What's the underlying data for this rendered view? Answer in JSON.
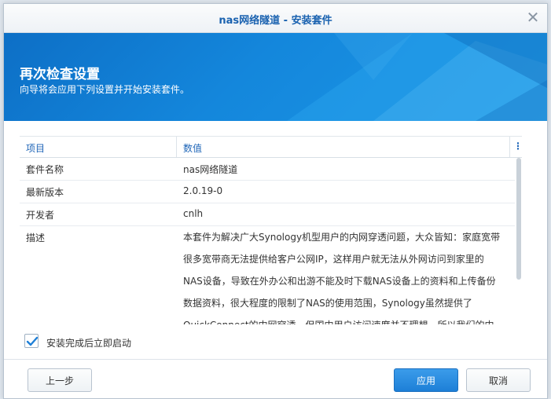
{
  "window": {
    "title": "nas网络隧道 - 安装套件",
    "close_glyph": "✕"
  },
  "banner": {
    "title": "再次检查设置",
    "subtitle": "向导将会应用下列设置并开始安装套件。"
  },
  "grid": {
    "headers": [
      "项目",
      "数值"
    ],
    "rows": [
      {
        "key": "套件名称",
        "value": "nas网络隧道"
      },
      {
        "key": "最新版本",
        "value": "2.0.19-0"
      },
      {
        "key": "开发者",
        "value": "cnlh"
      }
    ],
    "description": {
      "key": "描述",
      "lines": [
        "本套件为解决广大Synology机型用户的内网穿透问题，大众皆知：家庭宽带",
        "很多宽带商无法提供给客户公网IP，这样用户就无法从外网访问到家里的",
        "NAS设备，导致在外办公和出游不能及时下载NAS设备上的资料和上传备份",
        "数据资料，很大程度的限制了NAS的使用范围，Synology虽然提供了",
        "QuickConnect的内网穿透，但国内用户访问速度并不理想，所以我们的内"
      ]
    }
  },
  "options": {
    "start_after_install": {
      "label": "安装完成后立即启动",
      "checked": true
    }
  },
  "buttons": {
    "prev": "上一步",
    "apply": "应用",
    "cancel": "取消"
  },
  "colors": {
    "accent": "#1a62b0",
    "banner": "#1487dc",
    "apply_button": "#1d7fd7"
  }
}
